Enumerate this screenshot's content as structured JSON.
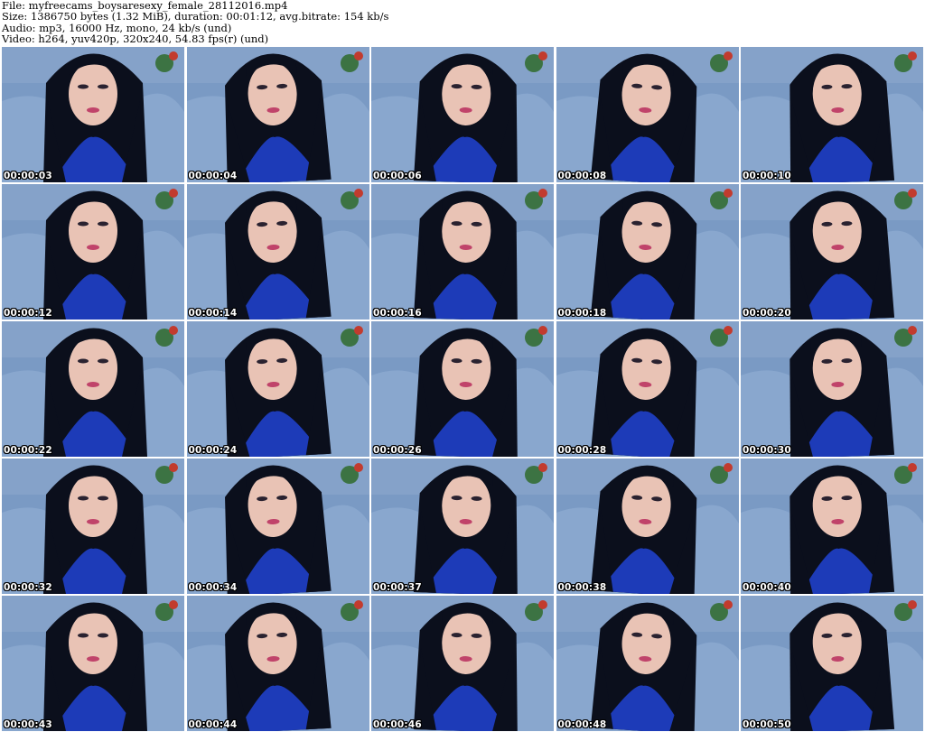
{
  "info": {
    "file": "File: myfreecams_boysaresexy_female_28112016.mp4",
    "size": "Size: 1386750 bytes (1.32 MiB), duration: 00:01:12, avg.bitrate: 154 kb/s",
    "audio": "Audio: mp3, 16000 Hz, mono, 24 kb/s (und)",
    "video": "Video: h264, yuv420p, 320x240, 54.83 fps(r) (und)"
  },
  "colors": {
    "background_wall": "#7a9ac4",
    "hair": "#0b0f1c",
    "skin": "#e9c3b5",
    "robe": "#1d3bb8",
    "lips": "#c0436a"
  },
  "thumbnails": [
    {
      "time": "00:00:03"
    },
    {
      "time": "00:00:04"
    },
    {
      "time": "00:00:06"
    },
    {
      "time": "00:00:08"
    },
    {
      "time": "00:00:10"
    },
    {
      "time": "00:00:12"
    },
    {
      "time": "00:00:14"
    },
    {
      "time": "00:00:16"
    },
    {
      "time": "00:00:18"
    },
    {
      "time": "00:00:20"
    },
    {
      "time": "00:00:22"
    },
    {
      "time": "00:00:24"
    },
    {
      "time": "00:00:26"
    },
    {
      "time": "00:00:28"
    },
    {
      "time": "00:00:30"
    },
    {
      "time": "00:00:32"
    },
    {
      "time": "00:00:34"
    },
    {
      "time": "00:00:37"
    },
    {
      "time": "00:00:38"
    },
    {
      "time": "00:00:40"
    },
    {
      "time": "00:00:43"
    },
    {
      "time": "00:00:44"
    },
    {
      "time": "00:00:46"
    },
    {
      "time": "00:00:48"
    },
    {
      "time": "00:00:50"
    }
  ]
}
